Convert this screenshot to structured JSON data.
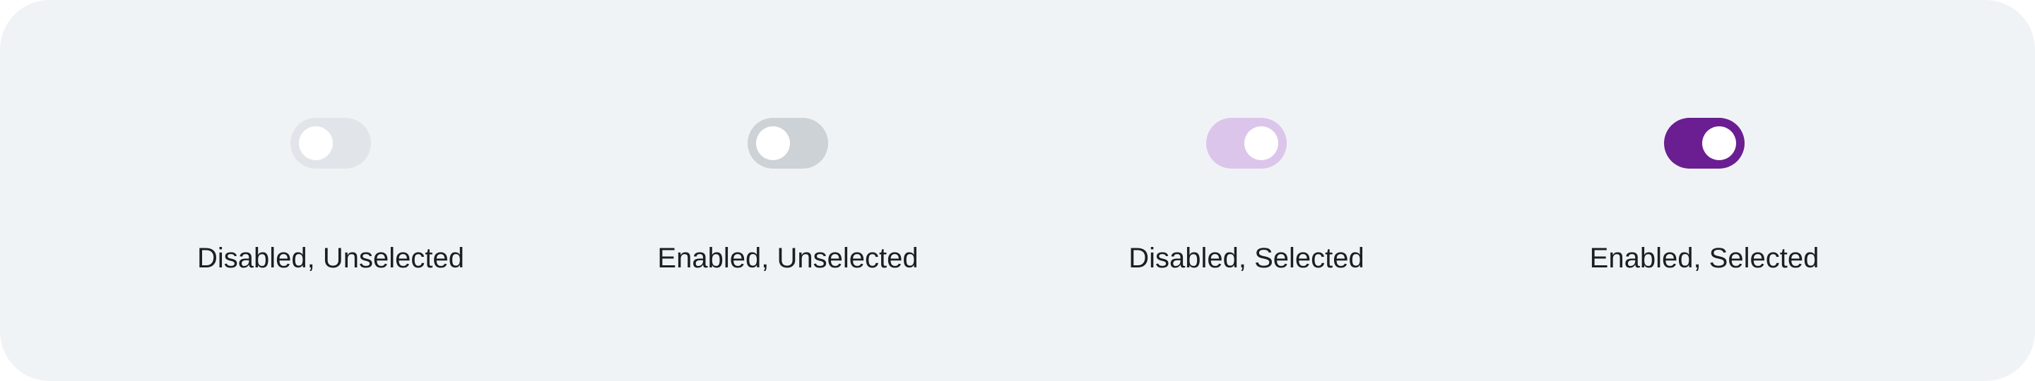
{
  "toggles": [
    {
      "label": "Disabled, Unselected",
      "state": "disabled-unselected",
      "selected": false,
      "enabled": false,
      "track_color": "#e1e5ea"
    },
    {
      "label": "Enabled, Unselected",
      "state": "enabled-unselected",
      "selected": false,
      "enabled": true,
      "track_color": "#cdd2d7"
    },
    {
      "label": "Disabled, Selected",
      "state": "disabled-selected",
      "selected": true,
      "enabled": false,
      "track_color": "#dcc5ea"
    },
    {
      "label": "Enabled, Selected",
      "state": "enabled-selected",
      "selected": true,
      "enabled": true,
      "track_color": "#6a1e91"
    }
  ],
  "colors": {
    "background": "#f0f3f6",
    "knob": "#ffffff",
    "text": "#1b1f24",
    "accent": "#6a1e91"
  }
}
